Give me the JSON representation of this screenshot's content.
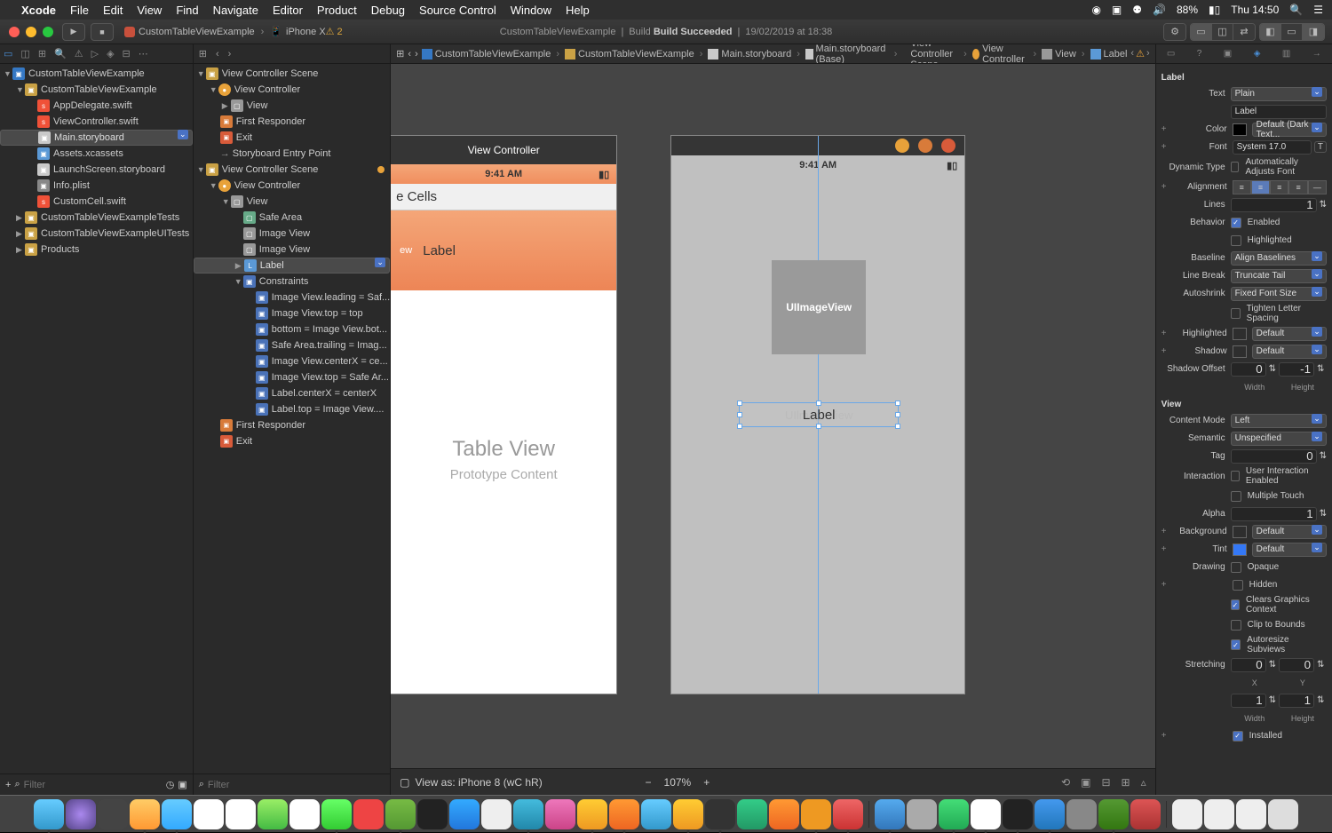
{
  "menubar": {
    "app": "Xcode",
    "items": [
      "File",
      "Edit",
      "View",
      "Find",
      "Navigate",
      "Editor",
      "Product",
      "Debug",
      "Source Control",
      "Window",
      "Help"
    ],
    "battery": "88%",
    "clock": "Thu 14:50"
  },
  "toolbar": {
    "scheme_target": "CustomTableViewExample",
    "scheme_device": "iPhone X",
    "activity_proj": "CustomTableViewExample",
    "activity_status": "Build Succeeded",
    "activity_time": "19/02/2019 at 18:38",
    "warnings": "2"
  },
  "navigator": {
    "project": "CustomTableViewExample",
    "group1": "CustomTableViewExample",
    "files1": [
      "AppDelegate.swift",
      "ViewController.swift",
      "Main.storyboard",
      "Assets.xcassets",
      "LaunchScreen.storyboard",
      "Info.plist",
      "CustomCell.swift"
    ],
    "group2": "CustomTableViewExampleTests",
    "group3": "CustomTableViewExampleUITests",
    "group4": "Products",
    "filter_ph": "Filter"
  },
  "outline": {
    "scene1": "View Controller Scene",
    "vc": "View Controller",
    "view": "View",
    "fr": "First Responder",
    "exit": "Exit",
    "sep": "Storyboard Entry Point",
    "scene2": "View Controller Scene",
    "safe": "Safe Area",
    "iv1": "Image View",
    "iv2": "Image View",
    "label": "Label",
    "constraints": "Constraints",
    "c": [
      "Image View.leading = Saf...",
      "Image View.top = top",
      "bottom = Image View.bot...",
      "Safe Area.trailing = Imag...",
      "Image View.centerX = ce...",
      "Image View.top = Safe Ar...",
      "Label.centerX = centerX",
      "Label.top = Image View...."
    ],
    "filter_ph": "Filter"
  },
  "jumpbar": {
    "items": [
      "CustomTableViewExample",
      "CustomTableViewExample",
      "Main.storyboard",
      "Main.storyboard (Base)",
      "View Controller Scene",
      "View Controller",
      "View",
      "Label"
    ]
  },
  "canvas": {
    "vc_title": "View Controller",
    "time": "9:41 AM",
    "header": "e Cells",
    "cell_lbl_a": "ew",
    "cell_lbl": "Label",
    "tv_title": "Table View",
    "tv_sub": "Prototype Content",
    "imgview": "UIImageView",
    "label_bg": "UIlmageView",
    "label_fg": "Label",
    "viewas": "View as: iPhone 8 (wC hR)",
    "zoom": "107%"
  },
  "inspector": {
    "section_label": "Label",
    "text_label": "Text",
    "text_val": "Plain",
    "text_content": "Label",
    "color_label": "Color",
    "color_val": "Default (Dark Text...",
    "font_label": "Font",
    "font_val": "System 17.0",
    "dyn_label": "Dynamic Type",
    "dyn_chk": "Automatically Adjusts Font",
    "align_label": "Alignment",
    "lines_label": "Lines",
    "lines_val": "1",
    "behavior_label": "Behavior",
    "enabled": "Enabled",
    "highlighted_b": "Highlighted",
    "baseline_label": "Baseline",
    "baseline_val": "Align Baselines",
    "linebreak_label": "Line Break",
    "linebreak_val": "Truncate Tail",
    "autoshrink_label": "Autoshrink",
    "autoshrink_val": "Fixed Font Size",
    "tighten": "Tighten Letter Spacing",
    "highlighted_label": "Highlighted",
    "highlighted_val": "Default",
    "shadow_label": "Shadow",
    "shadow_val": "Default",
    "shadowoff_label": "Shadow Offset",
    "shadowoff_w": "0",
    "shadowoff_h": "-1",
    "width_l": "Width",
    "height_l": "Height",
    "section_view": "View",
    "cmode_label": "Content Mode",
    "cmode_val": "Left",
    "semantic_label": "Semantic",
    "semantic_val": "Unspecified",
    "tag_label": "Tag",
    "tag_val": "0",
    "interaction_label": "Interaction",
    "uie": "User Interaction Enabled",
    "mt": "Multiple Touch",
    "alpha_label": "Alpha",
    "alpha_val": "1",
    "bg_label": "Background",
    "bg_val": "Default",
    "tint_label": "Tint",
    "tint_val": "Default",
    "drawing_label": "Drawing",
    "opaque": "Opaque",
    "hidden": "Hidden",
    "cgc": "Clears Graphics Context",
    "ctb": "Clip to Bounds",
    "asv": "Autoresize Subviews",
    "stretching_label": "Stretching",
    "s_x": "0",
    "s_y": "0",
    "s_w": "1",
    "s_h": "1",
    "x_l": "X",
    "y_l": "Y",
    "installed": "Installed"
  }
}
